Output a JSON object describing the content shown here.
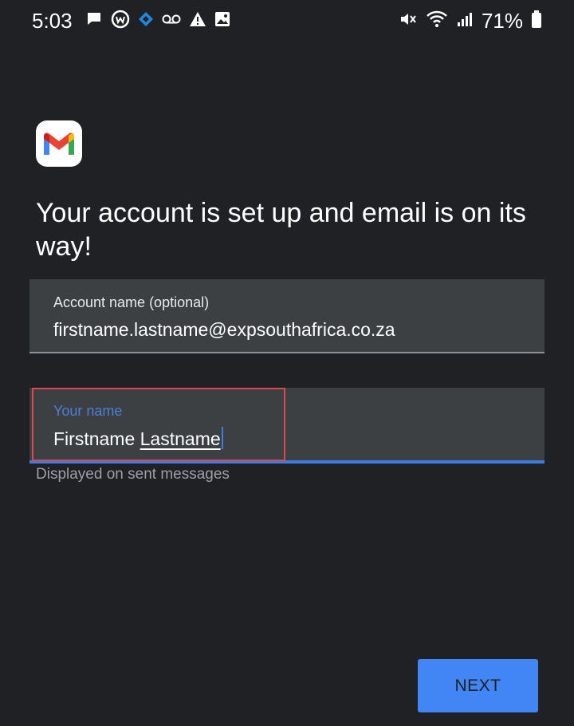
{
  "status_bar": {
    "time": "5:03",
    "battery_percent": "71%",
    "left_icons": [
      "chat-icon",
      "wear-icon",
      "diamond-icon",
      "voicemail-icon",
      "warning-icon",
      "image-icon"
    ],
    "right_icons": [
      "mute-icon",
      "wifi-icon",
      "signal-icon",
      "battery-icon"
    ]
  },
  "app_icon": "gmail-logo",
  "title": "Your account is set up and email is on its way!",
  "account_field": {
    "label": "Account name (optional)",
    "value": "firstname.lastname@expsouthafrica.co.za"
  },
  "name_field": {
    "label": "Your name",
    "value_first": "Firstname",
    "value_last": "Lastname",
    "helper": "Displayed on sent messages"
  },
  "next_label": "NEXT",
  "colors": {
    "background": "#202124",
    "field_background": "#3c4043",
    "accent": "#4285f4",
    "highlight": "#e0474c"
  }
}
